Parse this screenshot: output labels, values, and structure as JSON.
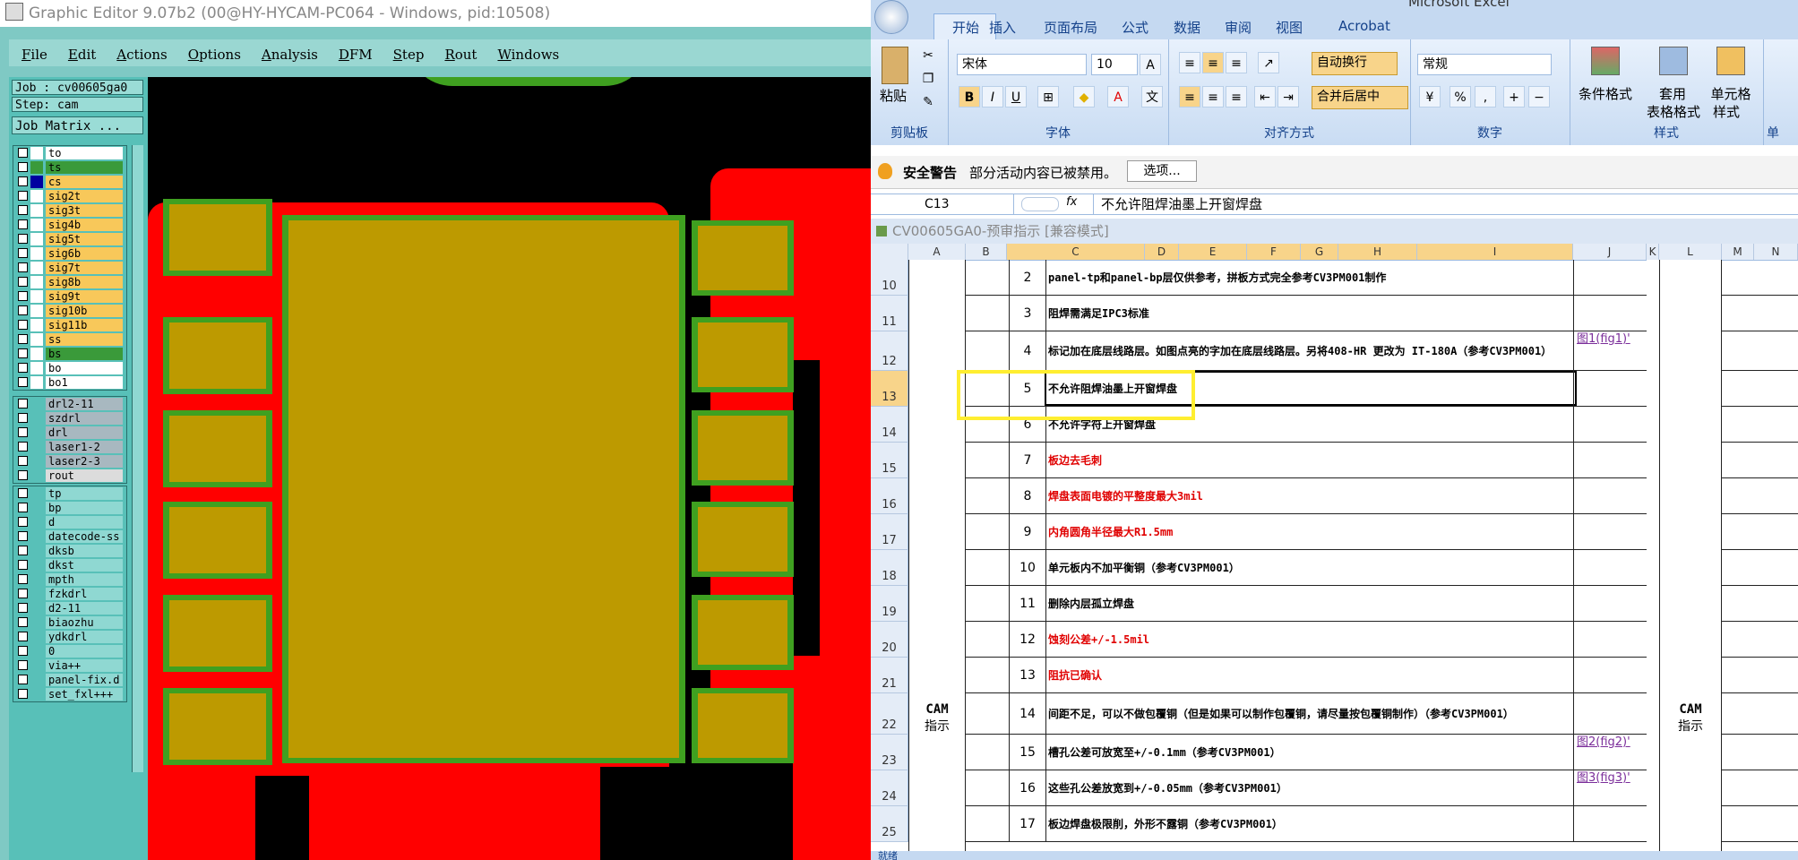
{
  "ge": {
    "title": "Graphic Editor 9.07b2 (00@HY-HYCAM-PC064 - Windows, pid:10508)",
    "menu": [
      "File",
      "Edit",
      "Actions",
      "Options",
      "Analysis",
      "DFM",
      "Step",
      "Rout",
      "Windows"
    ],
    "job": "Job : cv00605ga0",
    "step": "Step: cam",
    "matrix_button": "Job Matrix ...",
    "layers_group1": [
      {
        "name": "to",
        "color": "#ffffff",
        "swatch": "#ffffff"
      },
      {
        "name": "ts",
        "color": "#3a9a3a",
        "swatch": "#3a9a3a"
      },
      {
        "name": "cs",
        "color": "#f8c85a",
        "swatch": "#ff0000",
        "active": true
      },
      {
        "name": "sig2t",
        "color": "#f8c85a",
        "swatch": "#ffffff"
      },
      {
        "name": "sig3t",
        "color": "#f8c85a",
        "swatch": "#ffffff"
      },
      {
        "name": "sig4b",
        "color": "#f8c85a",
        "swatch": "#ffffff"
      },
      {
        "name": "sig5t",
        "color": "#f8c85a",
        "swatch": "#ffffff"
      },
      {
        "name": "sig6b",
        "color": "#f8c85a",
        "swatch": "#ffffff"
      },
      {
        "name": "sig7t",
        "color": "#f8c85a",
        "swatch": "#ffffff"
      },
      {
        "name": "sig8b",
        "color": "#f8c85a",
        "swatch": "#ffffff"
      },
      {
        "name": "sig9t",
        "color": "#f8c85a",
        "swatch": "#ffffff"
      },
      {
        "name": "sig10b",
        "color": "#f8c85a",
        "swatch": "#ffffff"
      },
      {
        "name": "sig11b",
        "color": "#f8c85a",
        "swatch": "#ffffff"
      },
      {
        "name": "ss",
        "color": "#f8c85a",
        "swatch": "#ffffff"
      },
      {
        "name": "bs",
        "color": "#3a9a3a",
        "swatch": "#ffffff"
      },
      {
        "name": "bo",
        "color": "#ffffff",
        "swatch": "#ffffff"
      },
      {
        "name": "bo1",
        "color": "#ffffff",
        "swatch": "#ffffff"
      }
    ],
    "layers_group2": [
      {
        "name": "drl2-11",
        "color": "#a8b8c0"
      },
      {
        "name": "szdrl",
        "color": "#a8b8c0"
      },
      {
        "name": "drl",
        "color": "#a8b8c0"
      },
      {
        "name": "laser1-2",
        "color": "#a8b8c0"
      },
      {
        "name": "laser2-3",
        "color": "#a8b8c0"
      },
      {
        "name": "rout",
        "color": "#dcdcdc"
      }
    ],
    "layers_group3": [
      {
        "name": "tp",
        "color": "#8fd8d2"
      },
      {
        "name": "bp",
        "color": "#8fd8d2"
      },
      {
        "name": "d",
        "color": "#8fd8d2"
      },
      {
        "name": "datecode-ss",
        "color": "#8fd8d2"
      },
      {
        "name": "dksb",
        "color": "#8fd8d2"
      },
      {
        "name": "dkst",
        "color": "#8fd8d2"
      },
      {
        "name": "mpth",
        "color": "#8fd8d2"
      },
      {
        "name": "fzkdrl",
        "color": "#8fd8d2"
      },
      {
        "name": "d2-11",
        "color": "#8fd8d2"
      },
      {
        "name": "biaozhu",
        "color": "#8fd8d2"
      },
      {
        "name": "ydkdrl",
        "color": "#8fd8d2"
      },
      {
        "name": "0",
        "color": "#8fd8d2"
      },
      {
        "name": "via++",
        "color": "#8fd8d2"
      },
      {
        "name": "panel-fix.d",
        "color": "#8fd8d2"
      },
      {
        "name": "set_fxl+++",
        "color": "#8fd8d2"
      }
    ]
  },
  "xl": {
    "app_title": "Microsoft Excel",
    "tabs": [
      "开始",
      "插入",
      "页面布局",
      "公式",
      "数据",
      "审阅",
      "视图",
      "Acrobat"
    ],
    "ribbon": {
      "paste": "粘贴",
      "clipboard": "剪贴板",
      "font_name": "宋体",
      "font_size": "10",
      "font_group": "字体",
      "wrap": "自动换行",
      "merge": "合并后居中",
      "align_group": "对齐方式",
      "number_format": "常规",
      "number_group": "数字",
      "cond_format": "条件格式",
      "table_format_1": "套用",
      "table_format_2": "表格格式",
      "cell_style_1": "单元格",
      "cell_style_2": "样式",
      "style_group": "样式",
      "cells_group": "单"
    },
    "warning_title": "安全警告",
    "warning_text": "部分活动内容已被禁用。",
    "warning_button": "选项...",
    "name_box": "C13",
    "fx": "fx",
    "formula": "不允许阻焊油墨上开窗焊盘",
    "doc_title": "CV00605GA0-预审指示  [兼容模式]",
    "columns": [
      "A",
      "B",
      "C",
      "D",
      "E",
      "F",
      "G",
      "H",
      "I",
      "J",
      "K",
      "L",
      "M",
      "N"
    ],
    "cam_label_1": "CAM",
    "cam_label_2": "指示",
    "status": "就绪",
    "rows": [
      {
        "row": "10",
        "num": "2",
        "text": "panel-tp和panel-bp层仅供参考，拼板方式完全参考CV3PM001制作",
        "red": false,
        "fig": ""
      },
      {
        "row": "11",
        "num": "3",
        "text": "阻焊需满足IPC3标准",
        "red": false,
        "fig": ""
      },
      {
        "row": "12",
        "num": "4",
        "text": "标记加在底层线路层。如图点亮的字加在底层线路层。另将408-HR 更改为 IT-180A（参考CV3PM001）",
        "red": false,
        "fig": "图1(fig1)'"
      },
      {
        "row": "13",
        "num": "5",
        "text": "不允许阻焊油墨上开窗焊盘",
        "red": false,
        "fig": ""
      },
      {
        "row": "14",
        "num": "6",
        "text": "不允许字符上开窗焊盘",
        "red": false,
        "fig": ""
      },
      {
        "row": "15",
        "num": "7",
        "text": "板边去毛刺",
        "red": true,
        "fig": ""
      },
      {
        "row": "16",
        "num": "8",
        "text": "焊盘表面电镀的平整度最大3mil",
        "red": true,
        "fig": ""
      },
      {
        "row": "17",
        "num": "9",
        "text": "内角圆角半径最大R1.5mm",
        "red": true,
        "fig": ""
      },
      {
        "row": "18",
        "num": "10",
        "text": "单元板内不加平衡铜（参考CV3PM001）",
        "red": false,
        "fig": ""
      },
      {
        "row": "19",
        "num": "11",
        "text": "删除内层孤立焊盘",
        "red": false,
        "fig": ""
      },
      {
        "row": "20",
        "num": "12",
        "text": "蚀刻公差+/-1.5mil",
        "red": true,
        "fig": ""
      },
      {
        "row": "21",
        "num": "13",
        "text": "阻抗已确认",
        "red": true,
        "fig": ""
      },
      {
        "row": "22",
        "num": "14",
        "text": "间距不足，可以不做包覆铜（但是如果可以制作包覆铜，请尽量按包覆铜制作）（参考CV3PM001）",
        "red": false,
        "fig": ""
      },
      {
        "row": "23",
        "num": "15",
        "text": "槽孔公差可放宽至+/-0.1mm（参考CV3PM001）",
        "red": false,
        "fig": "图2(fig2)'"
      },
      {
        "row": "24",
        "num": "16",
        "text": "这些孔公差放宽到+/-0.05mm（参考CV3PM001）",
        "red": false,
        "fig": "图3(fig3)'"
      },
      {
        "row": "25",
        "num": "17",
        "text": "板边焊盘极限削，外形不露铜（参考CV3PM001）",
        "red": false,
        "fig": ""
      }
    ]
  }
}
